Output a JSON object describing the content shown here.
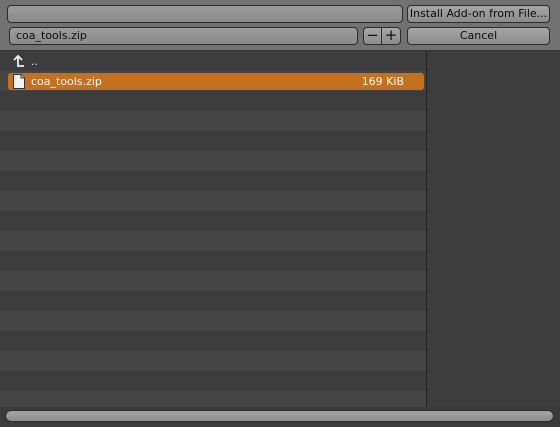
{
  "header": {
    "directory_path": "",
    "filename": "coa_tools.zip",
    "install_button_label": "Install Add-on from File...",
    "cancel_button_label": "Cancel",
    "decrement_label": "−",
    "increment_label": "+"
  },
  "file_list": {
    "parent_dir_label": "..",
    "files": [
      {
        "name": "coa_tools.zip",
        "size": "169 KiB",
        "selected": true,
        "icon": "file-icon"
      }
    ]
  },
  "colors": {
    "selection": "#c5701f",
    "header": "#727272",
    "background": "#3d3d3d"
  }
}
